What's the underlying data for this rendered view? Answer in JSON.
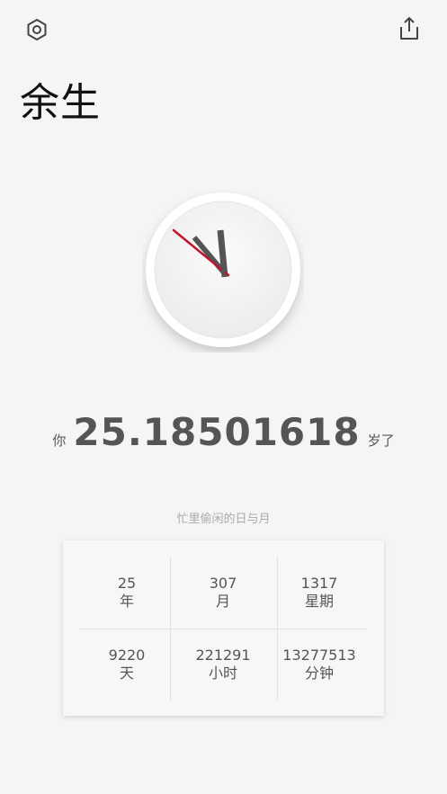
{
  "header": {
    "title": "余生",
    "settings_icon": "settings-hexagon-icon",
    "share_icon": "share-icon"
  },
  "clock": {
    "hour_hand_color": "#555555",
    "minute_hand_color": "#555555",
    "second_hand_color": "#c0152f",
    "face_color": "#f4f4f4"
  },
  "age": {
    "prefix": "你",
    "value": "25.18501618",
    "suffix": "岁了"
  },
  "stats": {
    "caption": "忙里偷闲的日与月",
    "items": [
      {
        "value": "25",
        "unit": "年"
      },
      {
        "value": "307",
        "unit": "月"
      },
      {
        "value": "1317",
        "unit": "星期"
      },
      {
        "value": "9220",
        "unit": "天"
      },
      {
        "value": "221291",
        "unit": "小时"
      },
      {
        "value": "13277513",
        "unit": "分钟"
      }
    ]
  }
}
